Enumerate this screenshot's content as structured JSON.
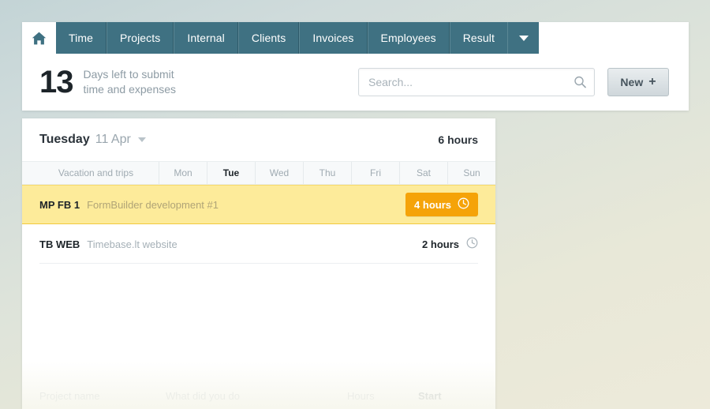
{
  "colors": {
    "nav_bg": "#3f7182",
    "accent_orange": "#f5a309",
    "highlight_yellow": "#fdeb9a",
    "text_dark": "#1d2429",
    "text_muted": "#9aa6ae"
  },
  "nav": {
    "home_icon": "home-icon",
    "tabs": [
      {
        "label": "Time"
      },
      {
        "label": "Projects"
      },
      {
        "label": "Internal"
      },
      {
        "label": "Clients"
      },
      {
        "label": "Invoices"
      },
      {
        "label": "Employees"
      },
      {
        "label": "Result"
      }
    ],
    "overflow_icon": "chevron-down-icon"
  },
  "summary": {
    "days_number": "13",
    "days_line1": "Days left to submit",
    "days_line2": "time and expenses"
  },
  "search": {
    "placeholder": "Search...",
    "value": "",
    "icon": "search-icon"
  },
  "new_button": {
    "label": "New",
    "plus": "+"
  },
  "panel": {
    "date_day": "Tuesday",
    "date_rest": "11 Apr",
    "date_caret_icon": "chevron-down-icon",
    "total_hours": "6 hours",
    "week": {
      "vacation_label": "Vacation and trips",
      "days": [
        {
          "label": "Mon",
          "active": false
        },
        {
          "label": "Tue",
          "active": true
        },
        {
          "label": "Wed",
          "active": false
        },
        {
          "label": "Thu",
          "active": false
        },
        {
          "label": "Fri",
          "active": false
        },
        {
          "label": "Sat",
          "active": false
        },
        {
          "label": "Sun",
          "active": false
        }
      ]
    },
    "rows": [
      {
        "code": "MP FB 1",
        "description": "FormBuilder development #1",
        "hours": "4 hours",
        "clock_icon": "clock-icon",
        "highlighted": true
      },
      {
        "code": "TB WEB",
        "description": "Timebase.lt website",
        "hours": "2 hours",
        "clock_icon": "clock-icon",
        "highlighted": false
      }
    ],
    "ghost_row": {
      "project_name": "Project name",
      "what_did_you_do": "What did you do",
      "hours": "Hours",
      "start": "Start"
    }
  }
}
